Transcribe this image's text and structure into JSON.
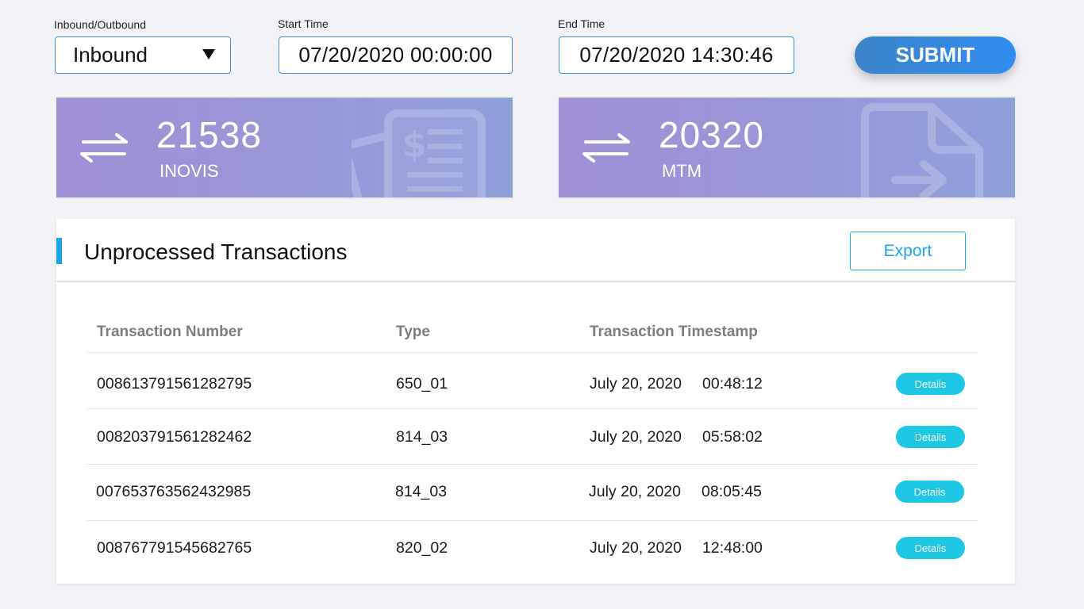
{
  "filters": {
    "direction_label": "Inbound/Outbound",
    "direction_value": "Inbound",
    "start_label": "Start Time",
    "start_value": "07/20/2020 00:00:00",
    "end_label": "End Time",
    "end_value": "07/20/2020 14:30:46",
    "submit_label": "SUBMIT"
  },
  "cards": [
    {
      "count": "21538",
      "label": "INOVIS",
      "icon": "invoice-icon"
    },
    {
      "count": "20320",
      "label": "MTM",
      "icon": "file-transfer-icon"
    }
  ],
  "panel": {
    "title": "Unprocessed Transactions",
    "export_label": "Export",
    "columns": [
      "Transaction Number",
      "Type",
      "Transaction Timestamp"
    ],
    "rows": [
      {
        "number": "008613791561282795",
        "type": "650_01",
        "date": "July 20, 2020",
        "time": "00:48:12",
        "action": "Details"
      },
      {
        "number": "008203791561282462",
        "type": "814_03",
        "date": "July 20, 2020",
        "time": "05:58:02",
        "action": "Details"
      },
      {
        "number": "007653763562432985",
        "type": "814_03",
        "date": "July 20, 2020",
        "time": "08:05:45",
        "action": "Details"
      },
      {
        "number": "008767791545682765",
        "type": "820_02",
        "date": "July 20, 2020",
        "time": "12:48:00",
        "action": "Details"
      }
    ]
  },
  "colors": {
    "accent": "#13a8ee",
    "submit": "#3d83c9",
    "details": "#1ec7e3",
    "card_gradient_start": "#a08fd6",
    "card_gradient_end": "#8fa0d9"
  }
}
